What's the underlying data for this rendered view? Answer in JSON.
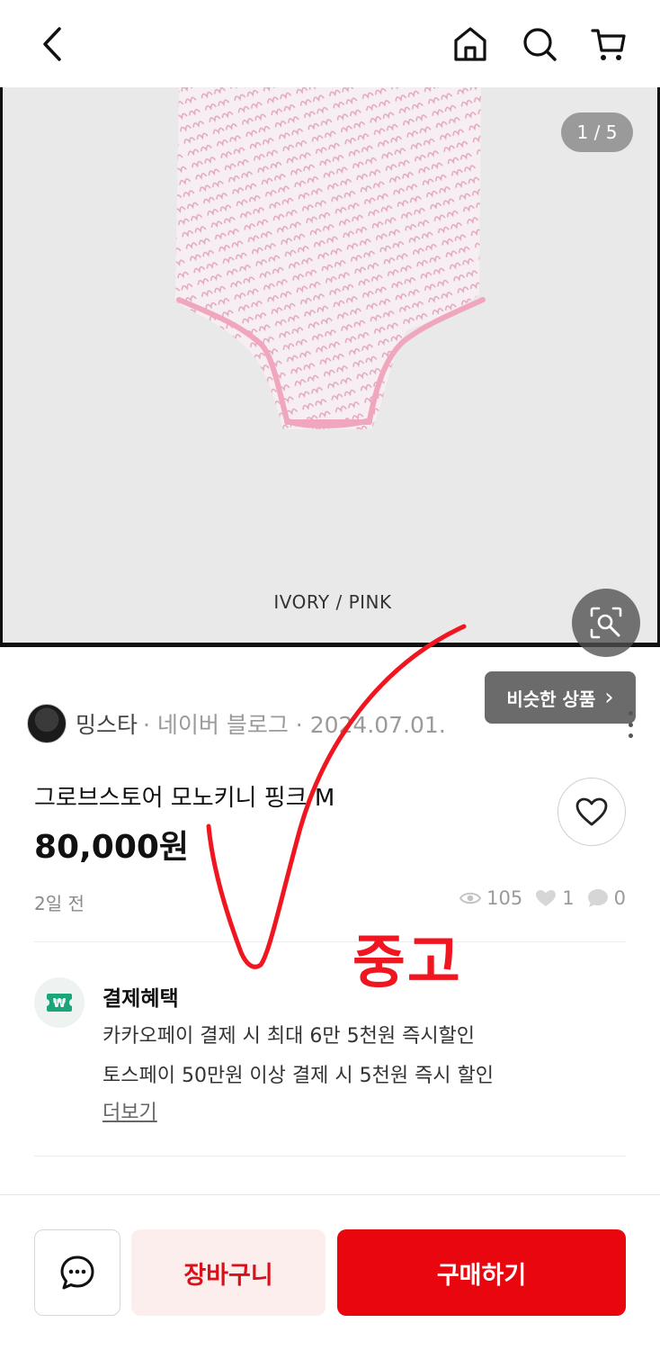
{
  "header": {
    "back_icon": "chevron-left-icon",
    "home_icon": "home-icon",
    "search_icon": "search-icon",
    "cart_icon": "cart-icon"
  },
  "gallery": {
    "counter": "1 / 5",
    "caption": "IVORY / PINK",
    "similar_label": "비슷한 상품",
    "similar_chevron": "›"
  },
  "seller": {
    "name": "밍스타",
    "meta": "· 네이버 블로그 · 2024.07.01."
  },
  "product": {
    "title": "그로브스토어 모노키니 핑크 M",
    "price": "80,000원",
    "posted": "2일 전",
    "views": "105",
    "likes": "1",
    "comments": "0"
  },
  "benefits": {
    "title": "결제혜택",
    "line1": "카카오페이 결제 시 최대 6만 5천원 즉시할인",
    "line2": "토스페이 50만원 이상 결제 시 5천원 즉시 할인",
    "more": "더보기",
    "icon_glyph": "₩"
  },
  "actions": {
    "cart_label": "장바구니",
    "buy_label": "구매하기"
  },
  "annotation": {
    "label": "중고",
    "color": "#ef1620"
  },
  "colors": {
    "accent": "#e8060f",
    "cart_bg": "#fdeeee",
    "cart_text": "#d9101a"
  }
}
